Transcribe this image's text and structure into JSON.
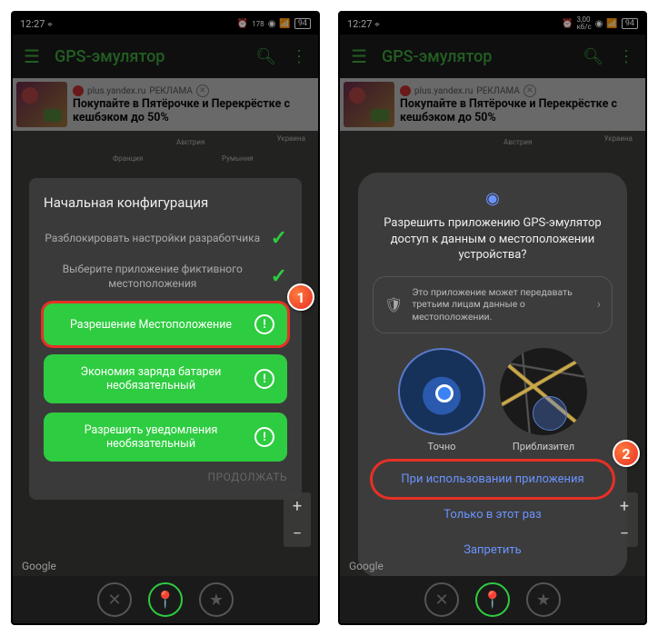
{
  "status": {
    "time": "12:27",
    "battery": "94",
    "data_label": "3,00",
    "data_unit": "кб/с",
    "extra_label": "178"
  },
  "app": {
    "title": "GPS-эмулятор"
  },
  "ad": {
    "domain": "plus.yandex.ru",
    "tag": "РЕКЛАМА",
    "title": "Покупайте в Пятёрочке и Перекрёстке с кешбэком до 50%"
  },
  "map": {
    "labels": [
      "Австрия",
      "Украина",
      "Франция",
      "Румыния"
    ]
  },
  "config": {
    "title": "Начальная конфигурация",
    "title_cut": "Нач",
    "rows": [
      "Разблокировать настройки разработчика",
      "Выберите приложение фиктивного местоположения"
    ],
    "buttons": [
      {
        "label": "Разрешение Местоположение"
      },
      {
        "label_line1": "Экономия заряда батареи",
        "label_line2": "необязательный"
      },
      {
        "label_line1": "Разрешить уведомления",
        "label_line2": "необязательный"
      }
    ],
    "continue": "ПРОДОЛЖАТЬ"
  },
  "perm": {
    "title": "Разрешить приложению GPS-эмулятор доступ к данным о местоположении устройства?",
    "info": "Это приложение может передавать третьим лицам данные о местоположении.",
    "precise": "Точно",
    "approx": "Приблизител",
    "while_using": "При использовании приложения",
    "once": "Только в этот раз",
    "deny": "Запретить"
  },
  "google": "Google",
  "badges": {
    "one": "1",
    "two": "2"
  }
}
